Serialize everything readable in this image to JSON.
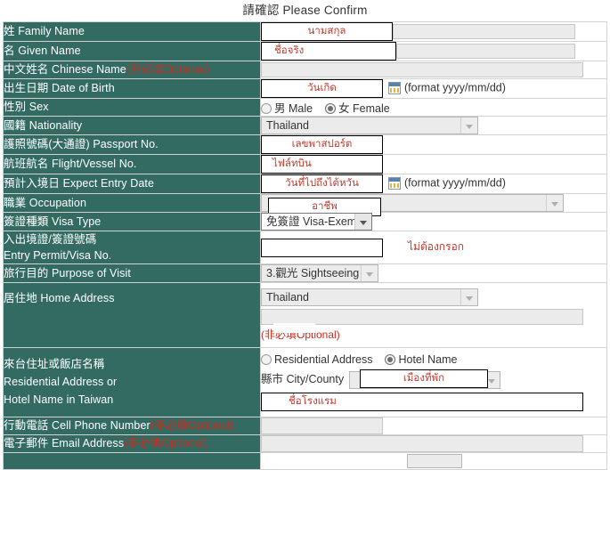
{
  "page": {
    "title": "請確認 Please Confirm",
    "optional_tag": "(非必填Optional)",
    "date_format_hint": "(format yyyy/mm/dd)"
  },
  "colors": {
    "label_cell": "#336b63",
    "annotation_red": "#c0392b",
    "field_fill": "#ebebeb"
  },
  "rows": {
    "family_name": {
      "label_cn": "姓",
      "label_en": "Family Name",
      "annotation": "นามสกุล"
    },
    "given_name": {
      "label_cn": "名",
      "label_en": "Given Name",
      "annotation": "ชื่อจริง"
    },
    "chinese_name": {
      "label_cn": "中文姓名",
      "label_en": "Chinese Name",
      "optional": "(非必填Optional)",
      "value": ""
    },
    "date_of_birth": {
      "label_cn": "出生日期",
      "label_en": "Date of Birth",
      "annotation": "วันเกิด",
      "hint": "(format yyyy/mm/dd)"
    },
    "sex": {
      "label_cn": "性別",
      "label_en": "Sex",
      "male_label": "男 Male",
      "female_label": "女 Female",
      "selected": "female"
    },
    "nationality": {
      "label_cn": "國籍",
      "label_en": "Nationality",
      "value": "Thailand"
    },
    "passport_no": {
      "label_cn": "護照號碼(大通證)",
      "label_en": "Passport No.",
      "annotation": "เลขพาสปอร์ต"
    },
    "flight_no": {
      "label_cn": "航班航名",
      "label_en": "Flight/Vessel No.",
      "annotation": "ไฟล์ทบิน"
    },
    "entry_date": {
      "label_cn": "預計入境日",
      "label_en": "Expect Entry Date",
      "annotation": "วันที่ไปถึงไต้หวัน",
      "hint": "(format yyyy/mm/dd)"
    },
    "occupation": {
      "label_cn": "職業",
      "label_en": "Occupation",
      "annotation": "อาชีพ",
      "value": ""
    },
    "visa_type": {
      "label_cn": "簽證種類",
      "label_en": "Visa Type",
      "value": "免簽證 Visa-Exempt"
    },
    "entry_permit": {
      "label_cn": "入出境證/簽證號碼",
      "label_en": "Entry Permit/Visa No.",
      "value": "",
      "note": "ไม่ต้องกรอก"
    },
    "purpose": {
      "label_cn": "旅行目的",
      "label_en": "Purpose of Visit",
      "value": "3.觀光 Sightseeing"
    },
    "home_address": {
      "label_cn": "居住地",
      "label_en": "Home Address",
      "country": "Thailand",
      "detail": "",
      "optional": "(非必填Optional)"
    },
    "taiwan_address": {
      "label_cn": "來台住址或飯店名稱",
      "label_en_1": "Residential Address or",
      "label_en_2": "Hotel Name in Taiwan",
      "residential_label": "Residential Address",
      "hotel_label": "Hotel Name",
      "selected": "hotel",
      "city_label": "縣市 City/County",
      "city_annotation": "เมืองที่พัก",
      "name_annotation": "ชื่อโรงแรม"
    },
    "cell_phone": {
      "label_cn": "行動電話",
      "label_en": "Cell Phone Number",
      "optional": "(非必填Optional)",
      "value": ""
    },
    "email": {
      "label_cn": "電子郵件",
      "label_en": "Email Address",
      "optional": "(非必填Optional)",
      "value": ""
    }
  }
}
